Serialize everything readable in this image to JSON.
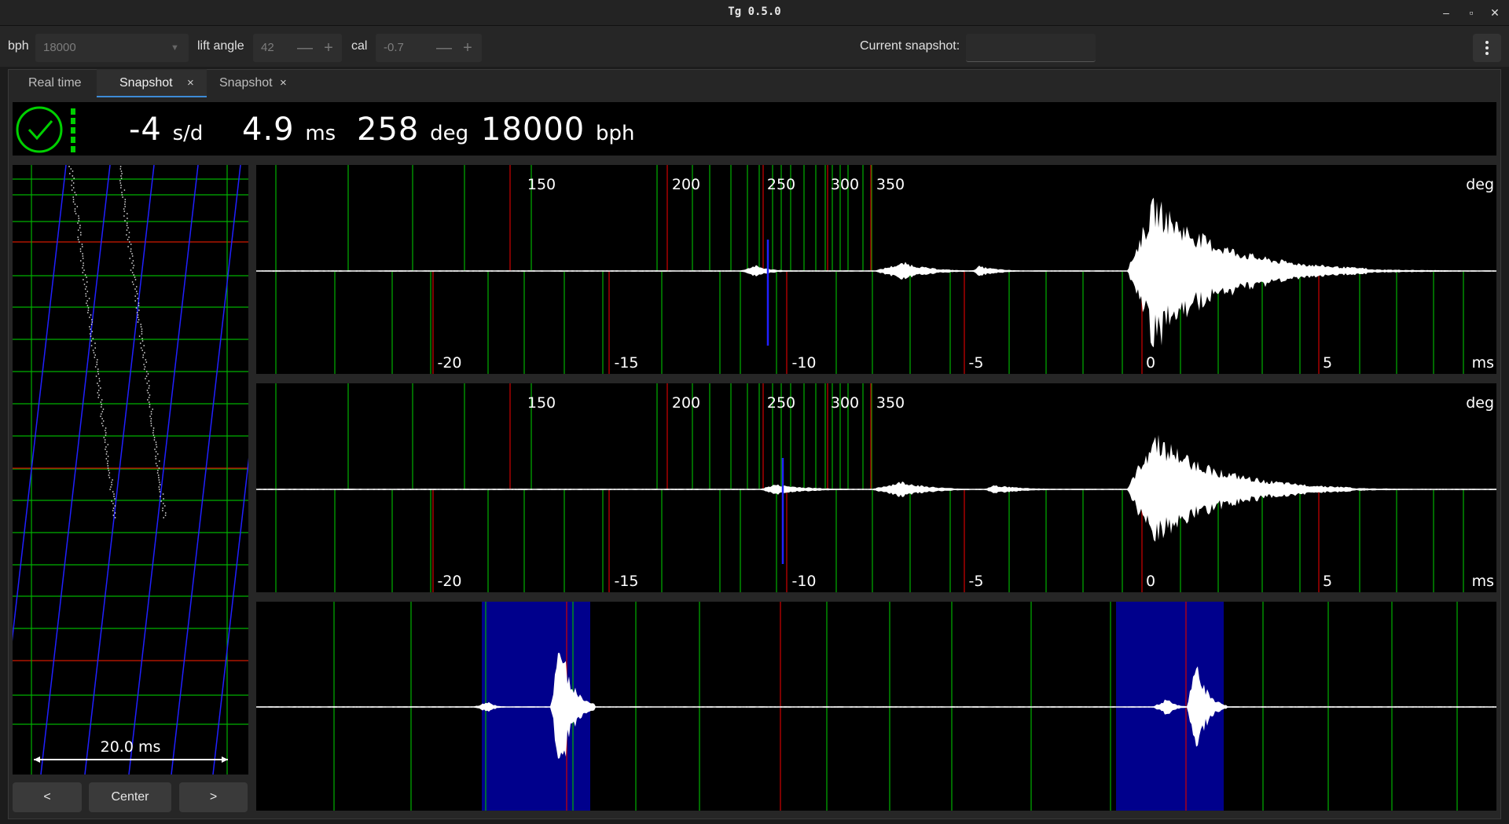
{
  "window": {
    "title": "Tg 0.5.0",
    "controls": {
      "minimize": "–",
      "maximize": "▫",
      "close": "✕"
    }
  },
  "toolbar": {
    "bph_label": "bph",
    "bph_value": "18000",
    "lift_angle_label": "lift angle",
    "lift_angle_value": "42",
    "cal_label": "cal",
    "cal_value": "-0.7",
    "minus": "—",
    "plus": "+",
    "current_snapshot_label": "Current snapshot:",
    "current_snapshot_value": ""
  },
  "tabs": [
    {
      "label": "Real time",
      "active": false,
      "closable": false
    },
    {
      "label": "Snapshot",
      "active": true,
      "closable": true
    },
    {
      "label": "Snapshot",
      "active": false,
      "closable": true
    }
  ],
  "tab_close": "×",
  "status": {
    "rate_value": "-4",
    "rate_unit": "s/d",
    "beat_error_value": "4.9",
    "beat_error_unit": "ms",
    "amplitude_value": "258",
    "amplitude_unit": "deg",
    "bph_value": "18000",
    "bph_unit": "bph",
    "indicator_color": "#00d000"
  },
  "paperstrip": {
    "scale_label": "20.0 ms",
    "prev_label": "<",
    "center_label": "Center",
    "next_label": ">"
  },
  "tic_plot": {
    "deg_labels": [
      "150",
      "200",
      "250",
      "300",
      "350"
    ],
    "deg_unit": "deg",
    "ms_labels": [
      "-20",
      "-15",
      "-10",
      "-5",
      "0",
      "5"
    ],
    "ms_unit": "ms"
  },
  "toc_plot": {
    "deg_labels": [
      "150",
      "200",
      "250",
      "300",
      "350"
    ],
    "deg_unit": "deg",
    "ms_labels": [
      "-20",
      "-15",
      "-10",
      "-5",
      "0",
      "5"
    ],
    "ms_unit": "ms"
  },
  "colors": {
    "grid_green": "#00b000",
    "grid_red": "#d00000",
    "marker_blue": "#2020ff",
    "highlight_blue": "#00008c",
    "waveform": "#ffffff"
  }
}
